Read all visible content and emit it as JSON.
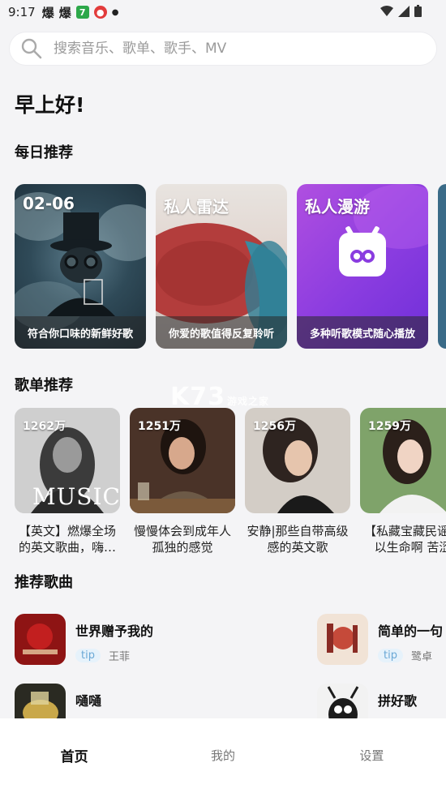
{
  "status_bar": {
    "time": "9:17",
    "icons": [
      "爆",
      "爆"
    ]
  },
  "search": {
    "placeholder": "搜索音乐、歌单、歌手、MV"
  },
  "greeting": "早上好!",
  "sections": {
    "daily": "每日推荐",
    "playlists": "歌单推荐",
    "songs": "推荐歌曲"
  },
  "daily": [
    {
      "tag": "02-06",
      "caption": "符合你口味的新鲜好歌"
    },
    {
      "tag": "私人雷达",
      "caption": "你爱的歌值得反复聆听"
    },
    {
      "tag": "私人漫游",
      "caption": "多种听歌模式随心播放"
    }
  ],
  "playlists": [
    {
      "count": "1262万",
      "title": "【英文】燃爆全场的英文歌曲，嗨…",
      "cover_text": "MUSIC"
    },
    {
      "count": "1251万",
      "title": "慢慢体会到成年人孤独的感觉"
    },
    {
      "count": "1256万",
      "title": "安静|那些自带高级感的英文歌"
    },
    {
      "count": "1259万",
      "title": "【私藏宝藏民谣所以生命啊 苦涩"
    }
  ],
  "watermark": {
    "main": "K73",
    "sub": "游戏之家"
  },
  "songs": [
    {
      "name": "世界赠予我的",
      "badge": "tip",
      "artist": "王菲"
    },
    {
      "name": "简单的一句",
      "badge": "tip",
      "artist": "鹭卓"
    },
    {
      "name": "嗵嗵",
      "badge": "",
      "artist": ""
    },
    {
      "name": "拼好歌",
      "badge": "",
      "artist": ""
    }
  ],
  "tabs": [
    "首页",
    "我的",
    "设置"
  ]
}
